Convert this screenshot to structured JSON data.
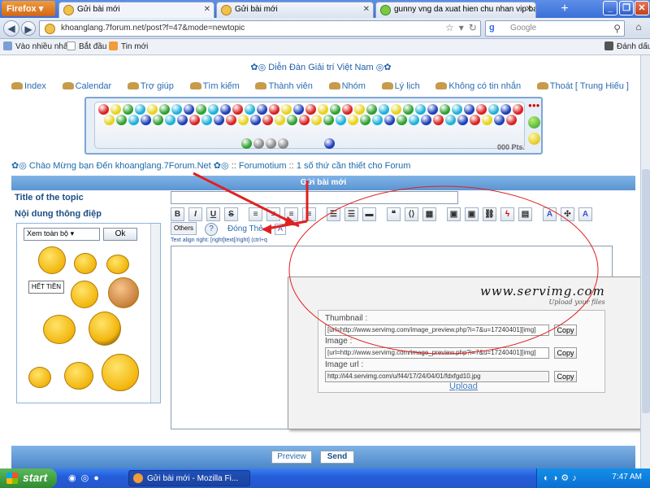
{
  "browser": {
    "app_button": "Firefox",
    "tabs": [
      {
        "label": "Gửi bài mới",
        "active": true
      },
      {
        "label": "Gửi bài mới",
        "active": false
      },
      {
        "label": "gunny vng da xuat hien chu nhan vip baz...",
        "active": false
      }
    ],
    "new_tab": "+",
    "url": "khoanglang.7forum.net/post?f=47&mode=newtopic",
    "search_engine": "g",
    "search_placeholder": "Google",
    "bookmarks": [
      "Vào nhiều nhất",
      "Bắt đầu",
      "Tin mới"
    ],
    "bookmarks_right": "Đánh dấu"
  },
  "page": {
    "site_title": "Diễn Đàn Giải trí Việt Nam",
    "nav": [
      "Index",
      "Calendar",
      "Trợ giúp",
      "Tìm kiếm",
      "Thành viên",
      "Nhóm",
      "Lý lịch",
      "Không có tin nhắn",
      "Thoát [ Trung Hiếu ]"
    ],
    "game_score": "000 Pts.",
    "breadcrumb": {
      "welcome": "Chào Mừng bạn Đến khoanglang.7Forum.Net",
      "sep1": "::",
      "section": "Forumotium",
      "sep2": "::",
      "topic": "1 số thứ cần thiết cho Forum"
    },
    "post_header": "Gửi bài mới",
    "title_label": "Title of the topic",
    "title_value": "",
    "message_label": "Nội dung thông điệp",
    "smiley_select": "Xem toàn bộ",
    "smiley_ok": "Ok",
    "smiley_tooltip": "HẾT TIỀN",
    "toolbar": {
      "bold": "B",
      "italic": "I",
      "underline": "U",
      "strike": "S"
    },
    "others_button": "Others",
    "close_tags": "Đóng Thẻ",
    "align_hint": "Text align right: [right]text[/right] (ctrl+q",
    "preview_button": "Preview",
    "send_button": "Send"
  },
  "servimg": {
    "logo": "www.servimg.com",
    "tagline": "Upload your files",
    "thumbnail_label": "Thumbnail :",
    "thumbnail_value": "[url=http://www.servimg.com/image_preview.php?i=7&u=17240401][img]",
    "image_label": "Image :",
    "image_value": "[url=http://www.servimg.com/image_preview.php?i=7&u=17240401][img]",
    "image_url_label": "Image url :",
    "image_url_value": "http://i44.servimg.com/u/f44/17/24/04/01/fdxfgd10.jpg",
    "copy_label": "Copy",
    "upload_link": "Upload"
  },
  "taskbar": {
    "start": "start",
    "task_item": "Gửi bài mới - Mozilla Fi...",
    "clock": "7:47 AM"
  },
  "colors": {
    "annotation": "#e02020",
    "header_blue": "#5b95d2",
    "link_blue": "#2a6db0"
  }
}
